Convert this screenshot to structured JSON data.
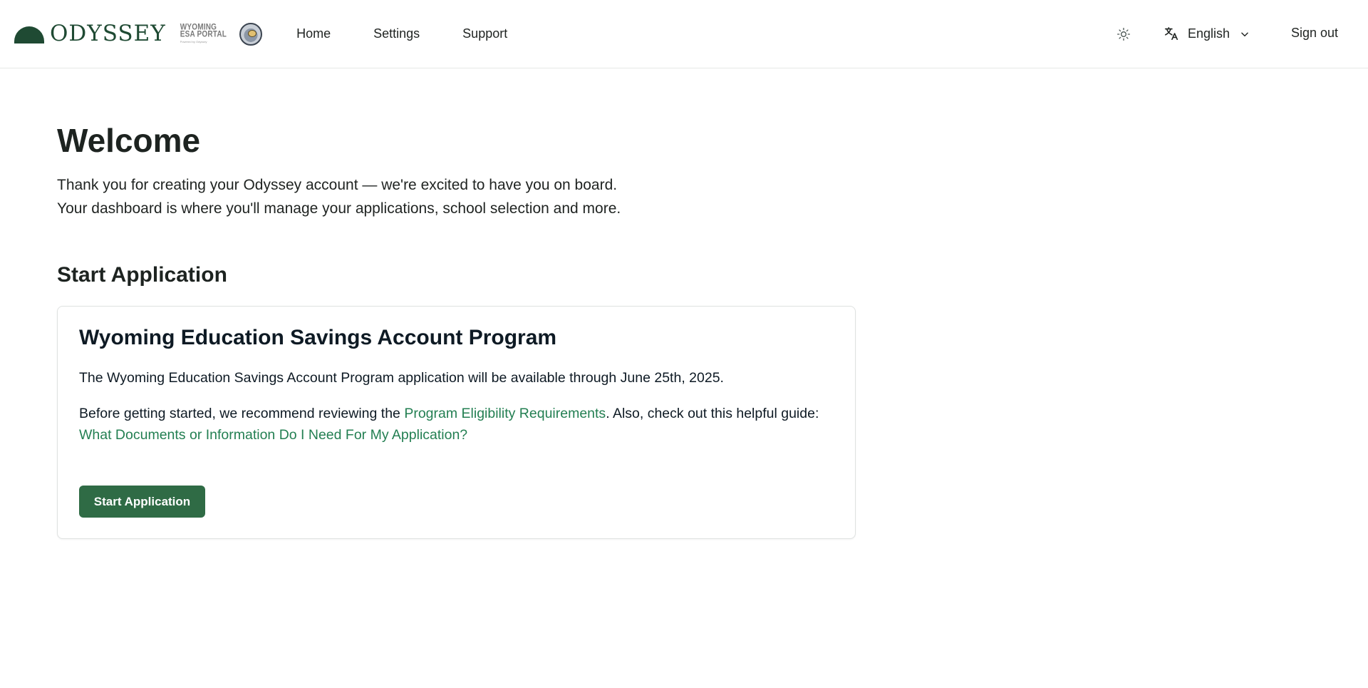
{
  "header": {
    "brand_name": "ODYSSEY",
    "portal_logo": {
      "line1": "WYOMING",
      "line2": "ESA PORTAL",
      "line3": "Powered by Odyssey"
    },
    "nav": [
      {
        "label": "Home"
      },
      {
        "label": "Settings"
      },
      {
        "label": "Support"
      }
    ],
    "theme_toggle_icon": "sun-icon",
    "language": {
      "icon": "translate-icon",
      "selected": "English"
    },
    "sign_out_label": "Sign out"
  },
  "main": {
    "title": "Welcome",
    "intro_line1": "Thank you for creating your Odyssey account — we're excited to have you on board.",
    "intro_line2": "Your dashboard is where you'll manage your applications, school selection and more.",
    "section_title": "Start Application",
    "card": {
      "title": "Wyoming Education Savings Account Program",
      "availability": "The Wyoming Education Savings Account Program application will be available through June 25th, 2025.",
      "guide_prefix": "Before getting started, we recommend reviewing the ",
      "eligibility_link": "Program Eligibility Requirements",
      "guide_middle": ". Also, check out this helpful guide: ",
      "documents_link": "What Documents or Information Do I Need For My Application?",
      "button_label": "Start Application"
    }
  },
  "colors": {
    "brand_green": "#1f4a33",
    "link_green": "#237f52",
    "button_green": "#2f6b45"
  }
}
